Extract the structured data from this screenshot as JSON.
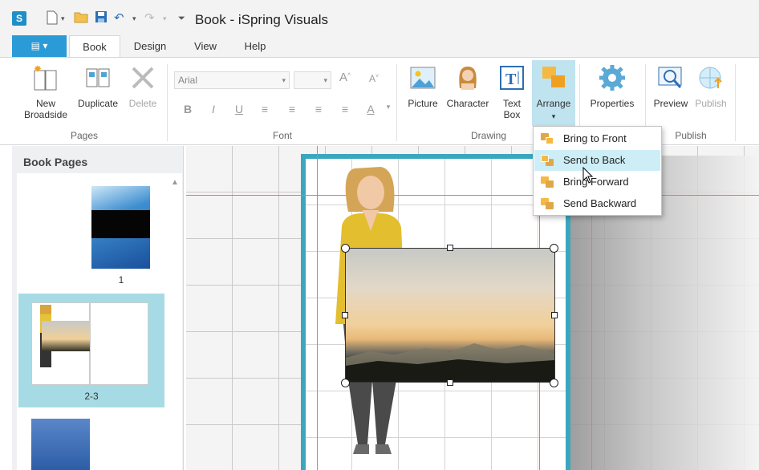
{
  "app": {
    "title": "Book - iSpring Visuals",
    "file_menu_label": "▤ ▾"
  },
  "quick_access": {
    "new_icon": "new-document-icon",
    "open_icon": "folder-icon",
    "save_icon": "save-icon",
    "undo_icon": "undo-icon",
    "redo_icon": "redo-icon"
  },
  "tabs": [
    {
      "label": "Book",
      "active": true
    },
    {
      "label": "Design",
      "active": false
    },
    {
      "label": "View",
      "active": false
    },
    {
      "label": "Help",
      "active": false
    }
  ],
  "ribbon": {
    "pages": {
      "label": "Pages",
      "new_broadside": "New\nBroadside",
      "duplicate": "Duplicate",
      "delete": "Delete"
    },
    "font": {
      "label": "Font",
      "family": "Arial",
      "size": ""
    },
    "drawing": {
      "label": "Drawing",
      "picture": "Picture",
      "character": "Character",
      "text_box": "Text\nBox",
      "arrange": "Arrange"
    },
    "properties": "Properties",
    "publish_group": {
      "label": "Publish",
      "preview": "Preview",
      "publish": "Publish"
    }
  },
  "arrange_menu": [
    {
      "label": "Bring to Front",
      "highlighted": false
    },
    {
      "label": "Send to Back",
      "highlighted": true
    },
    {
      "label": "Bring Forward",
      "highlighted": false
    },
    {
      "label": "Send Backward",
      "highlighted": false
    }
  ],
  "left_panel": {
    "title": "Book Pages",
    "thumbnails": [
      {
        "label": "1",
        "selected": false
      },
      {
        "label": "2-3",
        "selected": true
      },
      {
        "label": "",
        "selected": false
      }
    ]
  },
  "colors": {
    "accent": "#2a9bd6",
    "page_frame": "#3aa7bf",
    "selection": "#a6dbe5",
    "menu_highlight": "#cdeef6"
  }
}
